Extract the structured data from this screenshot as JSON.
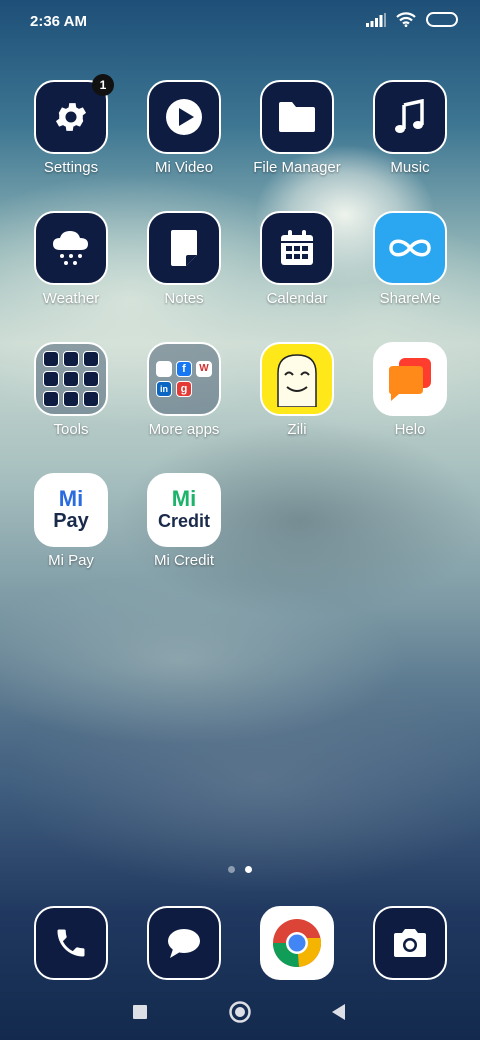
{
  "status": {
    "time": "2:36 AM",
    "icons": [
      "signal-icon",
      "wifi-icon",
      "battery-icon"
    ]
  },
  "apps": [
    {
      "label": "Settings",
      "icon": "gear-icon",
      "badge": "1"
    },
    {
      "label": "Mi Video",
      "icon": "play-icon"
    },
    {
      "label": "File Manager",
      "icon": "folder-icon"
    },
    {
      "label": "Music",
      "icon": "music-note-icon"
    },
    {
      "label": "Weather",
      "icon": "snow-cloud-icon"
    },
    {
      "label": "Notes",
      "icon": "note-icon"
    },
    {
      "label": "Calendar",
      "icon": "calendar-icon"
    },
    {
      "label": "ShareMe",
      "icon": "infinity-icon"
    },
    {
      "label": "Tools",
      "icon": "folder-grid-icon"
    },
    {
      "label": "More apps",
      "icon": "folder-grid-icon"
    },
    {
      "label": "Zili",
      "icon": "zili-face-icon"
    },
    {
      "label": "Helo",
      "icon": "helo-chat-icon"
    },
    {
      "label": "Mi Pay",
      "icon": "mi-pay-logo",
      "logo_line1": "Mi",
      "logo_line2": "Pay"
    },
    {
      "label": "Mi Credit",
      "icon": "mi-credit-logo",
      "logo_line1": "Mi",
      "logo_line2": "Credit"
    }
  ],
  "more_apps_glyphs": [
    "f",
    "W",
    "in",
    "g"
  ],
  "badge_color": "#111111",
  "icon_bg": "#0d1c40",
  "shareme_color": "#2aa7f0",
  "zili_color": "#ffe81a",
  "dock": [
    {
      "icon": "phone-icon"
    },
    {
      "icon": "message-icon"
    },
    {
      "icon": "chrome-icon"
    },
    {
      "icon": "camera-icon"
    }
  ],
  "page_indicator": {
    "pages": 2,
    "active": 2
  },
  "nav": {
    "icons": [
      "recents-square-icon",
      "home-circle-icon",
      "back-triangle-icon"
    ]
  }
}
